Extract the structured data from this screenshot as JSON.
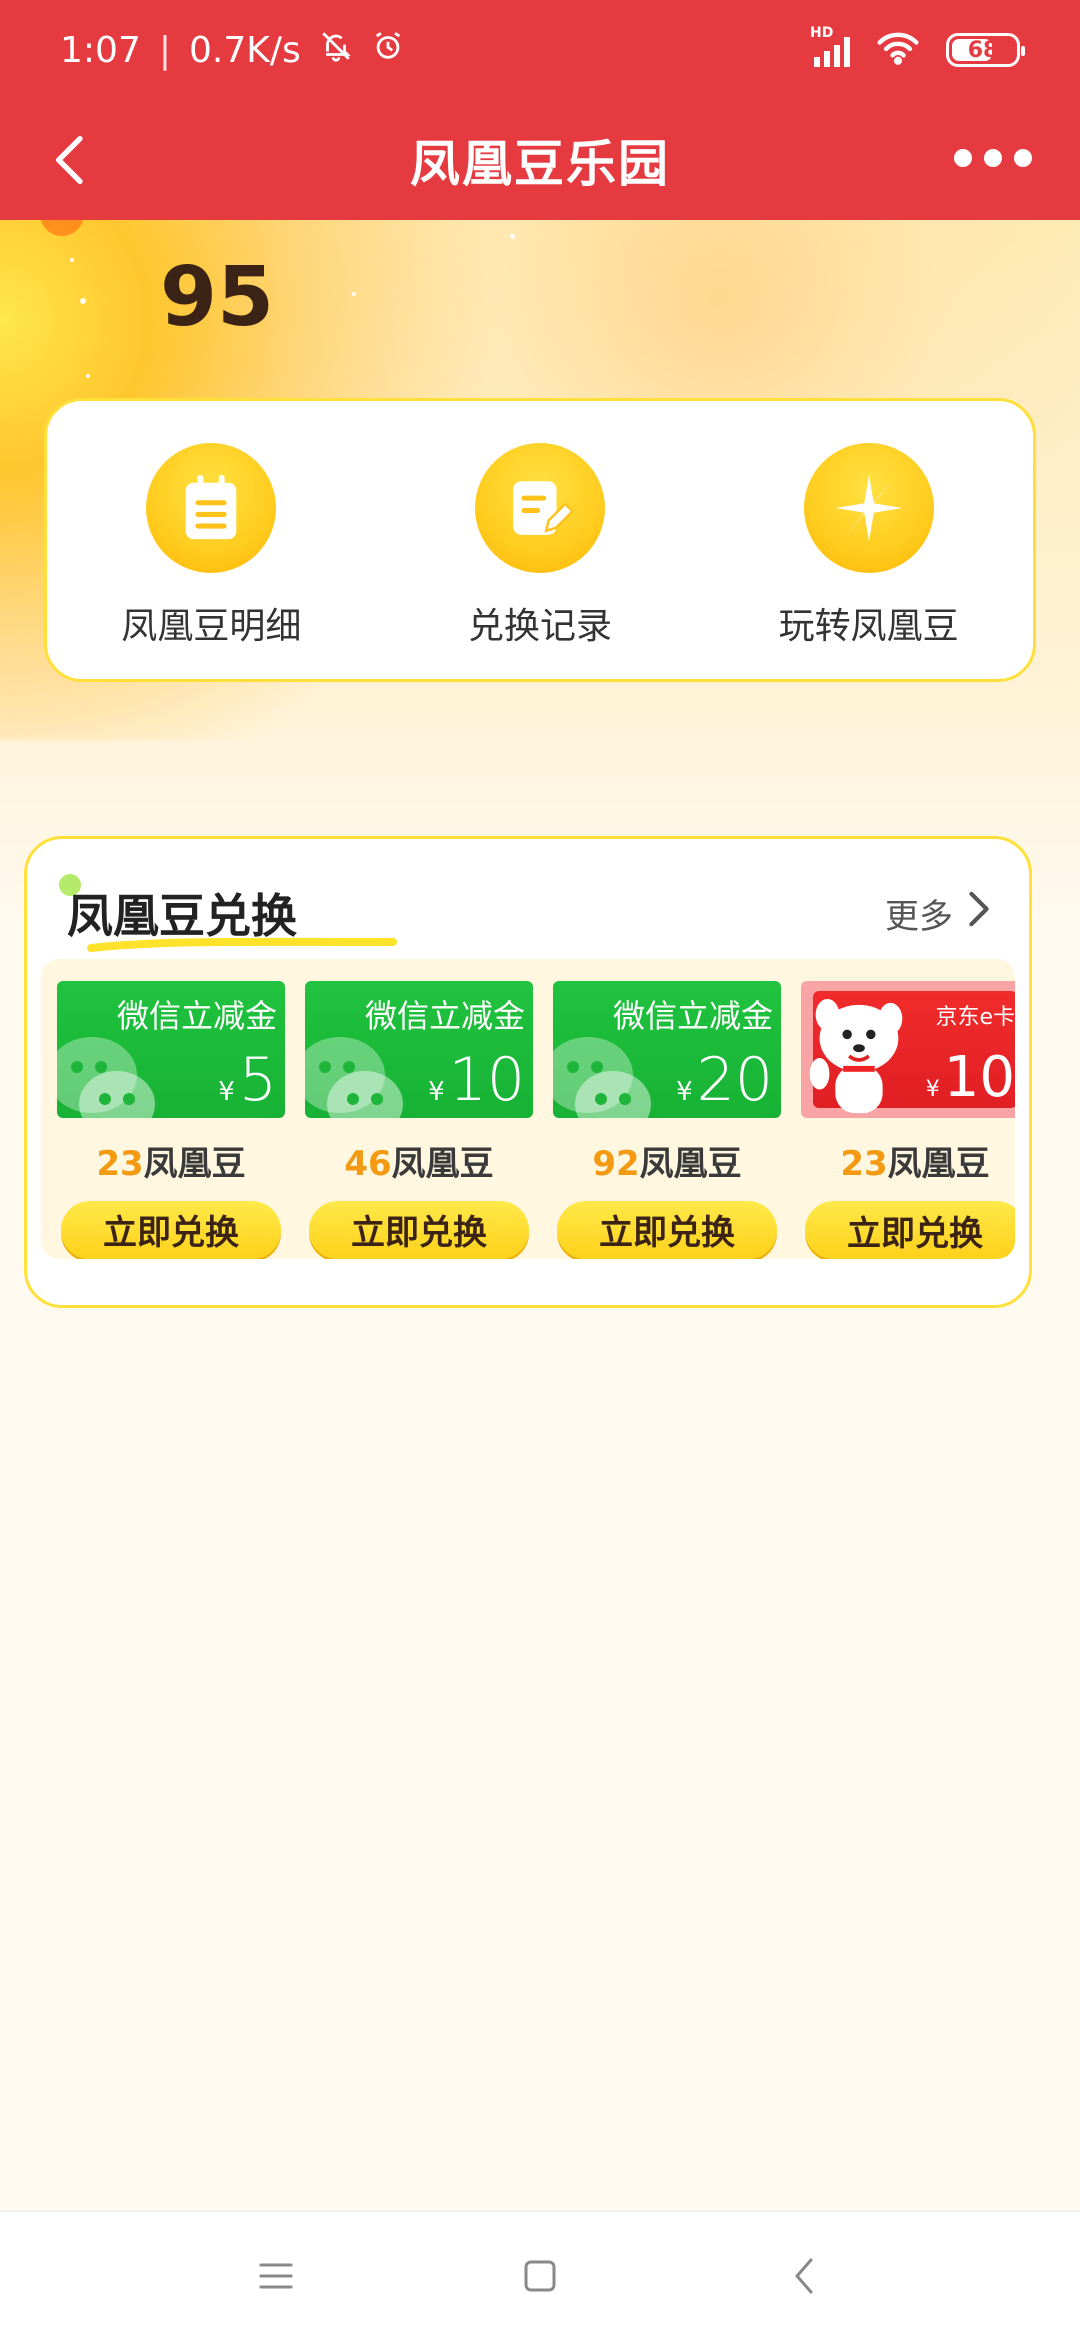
{
  "status_bar": {
    "time": "1:07",
    "network_speed": "0.7K/s",
    "network_type": "HD",
    "battery": "68"
  },
  "nav": {
    "title": "凤凰豆乐园"
  },
  "beans": {
    "count": "95"
  },
  "quick_actions": [
    {
      "label": "凤凰豆明细",
      "icon": "notepad-icon"
    },
    {
      "label": "兑换记录",
      "icon": "record-edit-icon"
    },
    {
      "label": "玩转凤凰豆",
      "icon": "pinwheel-icon"
    }
  ],
  "exchange": {
    "title": "凤凰豆兑换",
    "more_label": "更多",
    "items": [
      {
        "card_title": "微信立减金",
        "currency": "¥",
        "amount": "5",
        "cost": "23",
        "unit": "凤凰豆",
        "button": "立即兑换",
        "type": "wechat"
      },
      {
        "card_title": "微信立减金",
        "currency": "¥",
        "amount": "10",
        "cost": "46",
        "unit": "凤凰豆",
        "button": "立即兑换",
        "type": "wechat"
      },
      {
        "card_title": "微信立减金",
        "currency": "¥",
        "amount": "20",
        "cost": "92",
        "unit": "凤凰豆",
        "button": "立即兑换",
        "type": "wechat"
      },
      {
        "card_title": "京东e卡",
        "currency": "¥",
        "amount": "10",
        "cost": "23",
        "unit": "凤凰豆",
        "button": "立即兑换",
        "type": "jd"
      }
    ]
  },
  "colors": {
    "header_red": "#e63a41",
    "accent_yellow": "#ffd11a",
    "cost_orange": "#f39a12",
    "wechat_green": "#20c33f",
    "jd_red": "#e01f24"
  }
}
